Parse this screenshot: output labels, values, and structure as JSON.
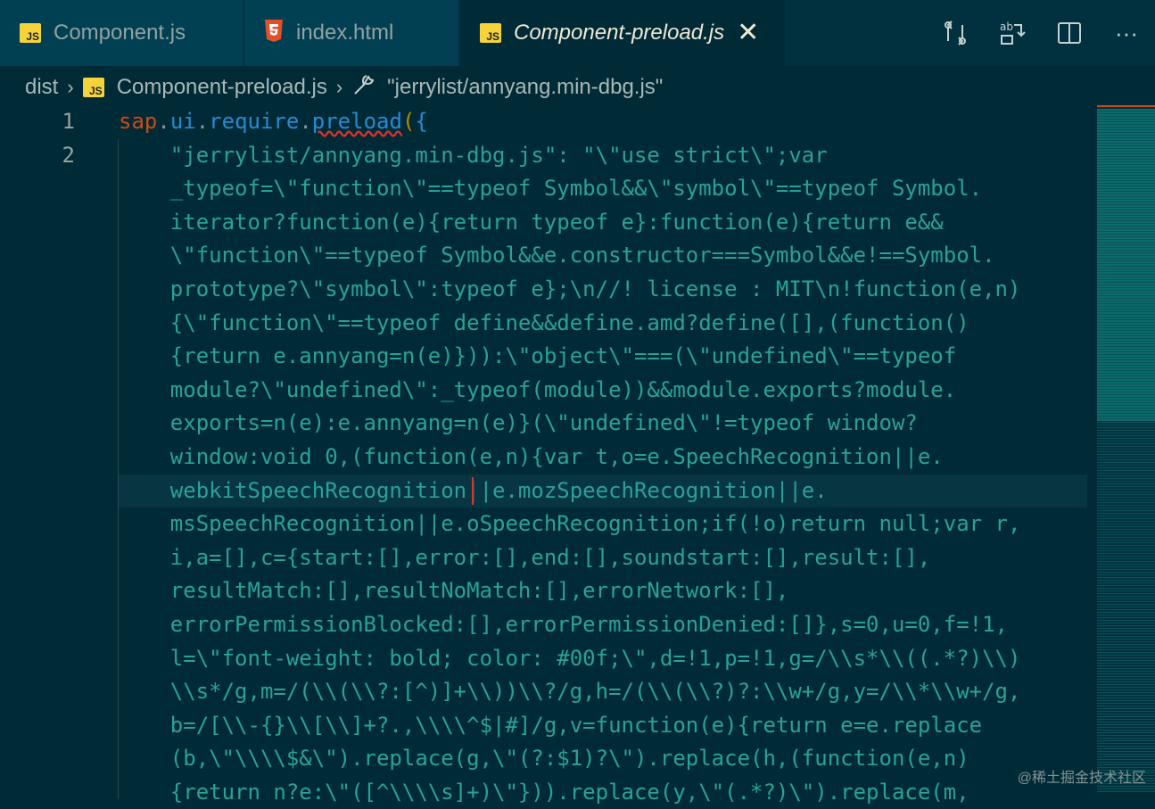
{
  "tabs": [
    {
      "label": "Component.js",
      "icon": "js-file-icon"
    },
    {
      "label": "index.html",
      "icon": "html5-file-icon"
    },
    {
      "label": "Component-preload.js",
      "icon": "js-file-icon",
      "active": true
    }
  ],
  "toolbar": {
    "icons": [
      "source-control-compare-icon",
      "replace-icon",
      "split-editor-icon",
      "more-actions-icon"
    ],
    "more_glyph": "···"
  },
  "breadcrumb": {
    "folder": "dist",
    "file": "Component-preload.js",
    "symbol": "\"jerrylist/annyang.min-dbg.js\""
  },
  "editor": {
    "line_numbers": [
      "1",
      "2"
    ],
    "lines": [
      "sap.ui.require.preload({",
      "    \"jerrylist/annyang.min-dbg.js\": \"\\\"use strict\\\";var",
      "    _typeof=\\\"function\\\"==typeof Symbol&&\\\"symbol\\\"==typeof Symbol.",
      "    iterator?function(e){return typeof e}:function(e){return e&&",
      "    \\\"function\\\"==typeof Symbol&&e.constructor===Symbol&&e!==Symbol.",
      "    prototype?\\\"symbol\\\":typeof e};\\n//! license : MIT\\n!function(e,n)",
      "    {\\\"function\\\"==typeof define&&define.amd?define([],(function()",
      "    {return e.annyang=n(e)})):\\\"object\\\"===(\\\"undefined\\\"==typeof",
      "    module?\\\"undefined\\\":_typeof(module))&&module.exports?module.",
      "    exports=n(e):e.annyang=n(e)}(\\\"undefined\\\"!=typeof window?",
      "    window:void 0,(function(e,n){var t,o=e.SpeechRecognition||e.",
      "    webkitSpeechRecognition||e.mozSpeechRecognition||e.",
      "    msSpeechRecognition||e.oSpeechRecognition;if(!o)return null;var r,",
      "    i,a=[],c={start:[],error:[],end:[],soundstart:[],result:[],",
      "    resultMatch:[],resultNoMatch:[],errorNetwork:[],",
      "    errorPermissionBlocked:[],errorPermissionDenied:[]},s=0,u=0,f=!1,",
      "    l=\\\"font-weight: bold; color: #00f;\\\",d=!1,p=!1,g=/\\\\s*\\\\((.*?)\\\\)",
      "    \\\\s*/g,m=/(\\\\(\\\\?:[^)]+\\\\))\\\\?/g,h=/(\\\\(\\\\?)?:\\\\w+/g,y=/\\\\*\\\\w+/g,",
      "    b=/[\\\\-{}\\\\[\\\\]+?.,\\\\\\\\^$|#]/g,v=function(e){return e=e.replace",
      "    (b,\\\"\\\\\\\\$&\\\").replace(g,\\\"(?:$1)?\\\").replace(h,(function(e,n)",
      "    {return n?e:\\\"([^\\\\\\\\s]+)\\\"})).replace(y,\\\"(.*?)\\\").replace(m,"
    ]
  },
  "watermark": "@稀土掘金技术社区",
  "colors": {
    "background": "#002b36",
    "tab_inactive": "#004052",
    "string": "#2aa198",
    "keyword": "#268bd2",
    "punctuation": "#cb4b16",
    "cursor": "#dc322f"
  }
}
